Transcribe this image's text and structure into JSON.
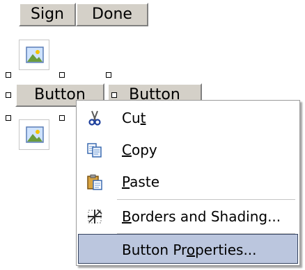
{
  "form": {
    "sign_button": "Sign",
    "done_button": "Done",
    "button1_label": "Button",
    "button2_label": "Button",
    "image_icon": "picture-icon"
  },
  "context_menu": {
    "items": [
      {
        "pre": "Cu",
        "key": "t",
        "post": "",
        "icon": "scissors-icon"
      },
      {
        "pre": "",
        "key": "C",
        "post": "opy",
        "icon": "copy-icon"
      },
      {
        "pre": "",
        "key": "P",
        "post": "aste",
        "icon": "paste-icon"
      },
      {
        "pre": "",
        "key": "B",
        "post": "orders and Shading...",
        "icon": "borders-icon"
      },
      {
        "pre": "Button Pr",
        "key": "o",
        "post": "perties...",
        "icon": ""
      }
    ],
    "highlighted_index": 4,
    "highlight_color": "#bbc6de"
  }
}
